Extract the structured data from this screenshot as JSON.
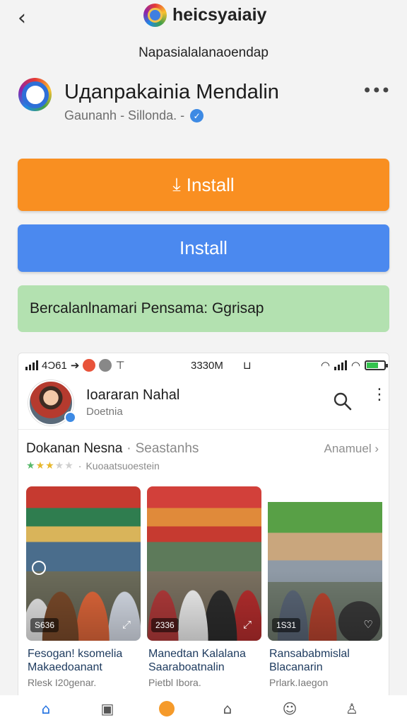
{
  "header": {
    "back_icon": "chevron-left-icon",
    "brand_name": "heicsyaiaiy",
    "subtitle": "Napasialalanaoendap"
  },
  "app": {
    "name": "Uдanpakainia Mendalin",
    "developer": "Gaunanh - Sillonda. -",
    "more_icon": "more-horizontal-icon"
  },
  "buttons": {
    "install_primary": "Install",
    "install_secondary": "Install",
    "promo_text": "Bercalanlnamari Pensama: Ggrisap"
  },
  "colors": {
    "orange": "#f98f21",
    "blue": "#4b89ef",
    "green": "#b3e1b0"
  },
  "phone": {
    "status": {
      "left_text": "4Ͻ61",
      "time": "3330M",
      "battery_percent": 65
    },
    "profile": {
      "name": "Ioararan Nahal",
      "sub": "Doetnia"
    },
    "section": {
      "title": "Dokanan Nesna",
      "title_muted": "Seastanhs",
      "more": "Anamuel",
      "rating_text": "Kuoaatsuoestein",
      "stars": 3.5
    },
    "cards": [
      {
        "badge": "S636",
        "line1": "Fesogan! ksomelia",
        "line2": "Makaedoanant",
        "line3": "Rlesk I20genar."
      },
      {
        "badge": "2336",
        "line1": "Manedtan Kalalana",
        "line2": "Saaraboatnalin",
        "line3": "Pietbl Ibora."
      },
      {
        "badge": "1S31",
        "line1": "Ransababmislal",
        "line2": "Blacanarin",
        "line3": "Prlark.Iaegon"
      }
    ]
  },
  "tabbar": {
    "items": [
      "home-icon",
      "inbox-icon",
      "create-icon",
      "house-icon",
      "emoji-icon",
      "profile-icon"
    ]
  }
}
